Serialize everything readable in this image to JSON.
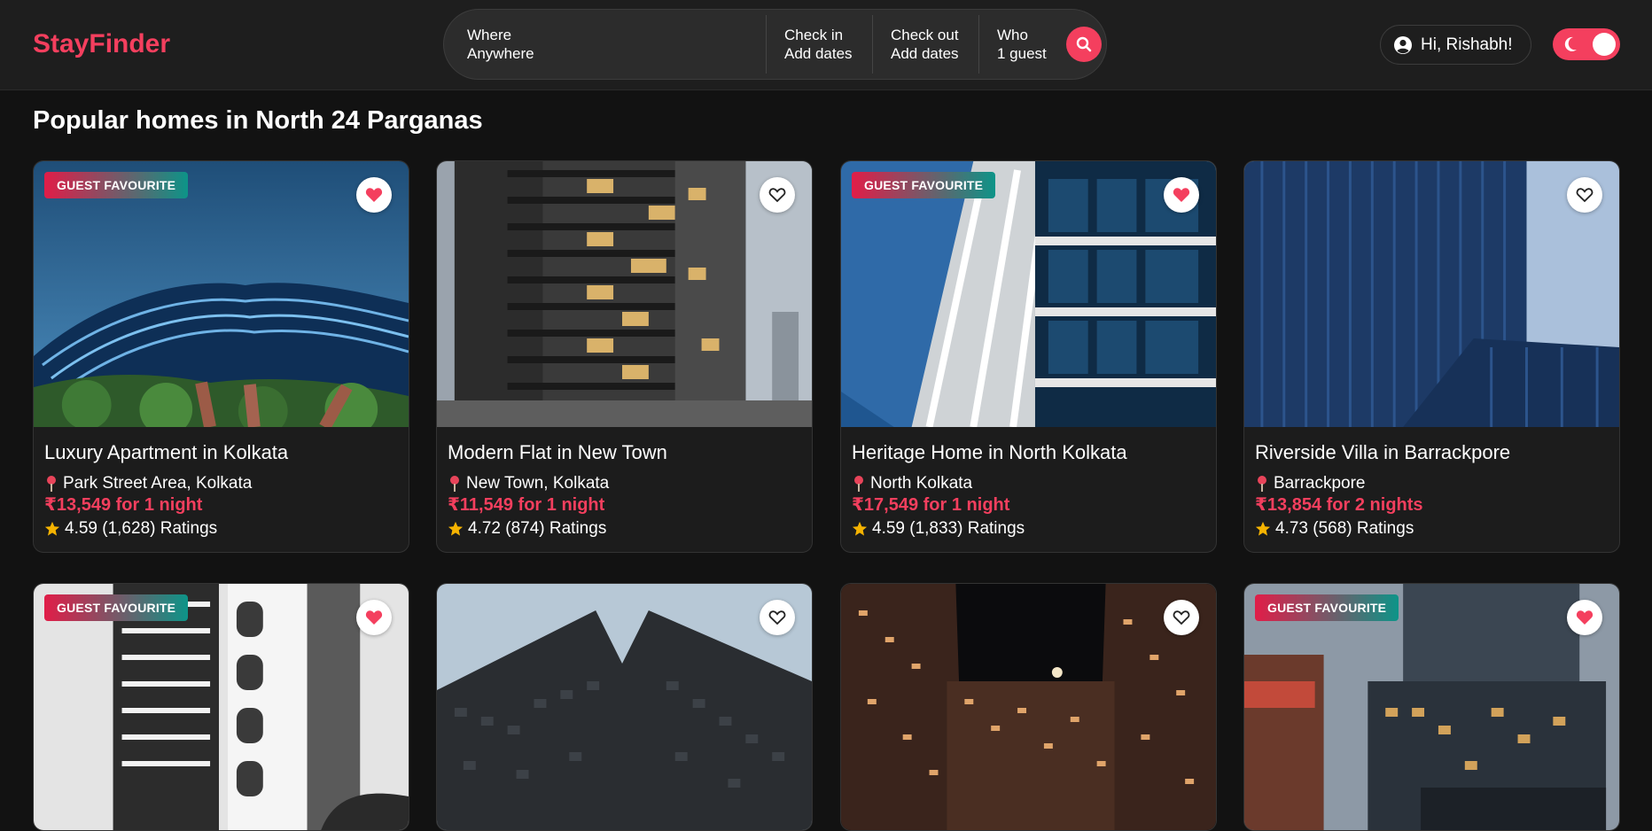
{
  "header": {
    "logo": "StayFinder",
    "search": {
      "where_label": "Where",
      "where_value": "Anywhere",
      "checkin_label": "Check in",
      "checkin_value": "Add dates",
      "checkout_label": "Check out",
      "checkout_value": "Add dates",
      "who_label": "Who",
      "who_value": "1 guest"
    },
    "user_greeting": "Hi, Rishabh!",
    "theme_toggle": "dark"
  },
  "section_title": "Popular homes in North 24 Parganas",
  "listings": [
    {
      "badge": "GUEST FAVOURITE",
      "favorited": true,
      "title": "Luxury Apartment in Kolkata",
      "location": "Park Street Area, Kolkata",
      "price": "₹13,549 for 1 night",
      "rating": "4.59 (1,628) Ratings"
    },
    {
      "badge": "",
      "favorited": false,
      "title": "Modern Flat in New Town",
      "location": "New Town, Kolkata",
      "price": "₹11,549 for 1 night",
      "rating": "4.72 (874) Ratings"
    },
    {
      "badge": "GUEST FAVOURITE",
      "favorited": true,
      "title": "Heritage Home in North Kolkata",
      "location": "North Kolkata",
      "price": "₹17,549 for 1 night",
      "rating": "4.59 (1,833) Ratings"
    },
    {
      "badge": "",
      "favorited": false,
      "title": "Riverside Villa in Barrackpore",
      "location": "Barrackpore",
      "price": "₹13,854 for 2 nights",
      "rating": "4.73 (568) Ratings"
    },
    {
      "badge": "GUEST FAVOURITE",
      "favorited": true
    },
    {
      "badge": "",
      "favorited": false
    },
    {
      "badge": "",
      "favorited": false
    },
    {
      "badge": "GUEST FAVOURITE",
      "favorited": true
    }
  ],
  "colors": {
    "accent": "#f43f5e",
    "background": "#121212",
    "surface": "#1e1e1e",
    "star": "#f5b301"
  }
}
